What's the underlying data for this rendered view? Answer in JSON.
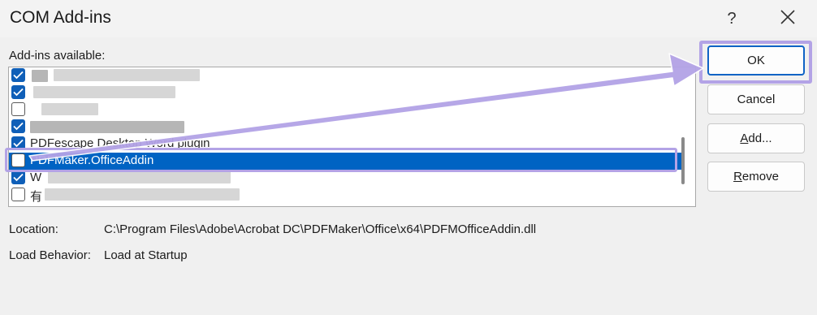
{
  "window": {
    "title": "COM Add-ins",
    "help_label": "?"
  },
  "addins": {
    "label": "Add-ins available:",
    "label_mnemonic": "d",
    "items": [
      {
        "checked": true,
        "text": ""
      },
      {
        "checked": true,
        "text": ""
      },
      {
        "checked": false,
        "text": ""
      },
      {
        "checked": true,
        "text": ""
      },
      {
        "checked": true,
        "text": "PDFescape Desktop Word plugin"
      },
      {
        "checked": false,
        "text": "PDFMaker.OfficeAddin",
        "selected": true
      },
      {
        "checked": true,
        "text": "W"
      },
      {
        "checked": false,
        "text": "有"
      }
    ]
  },
  "buttons": {
    "ok": "OK",
    "cancel": "Cancel",
    "add_mnemonic": "A",
    "add_rest": "dd...",
    "remove_mnemonic": "R",
    "remove_rest": "emove"
  },
  "details": {
    "location_label": "Location:",
    "location_value": "C:\\Program Files\\Adobe\\Acrobat DC\\PDFMaker\\Office\\x64\\PDFMOfficeAddin.dll",
    "load_behavior_label": "Load Behavior:",
    "load_behavior_value": "Load at Startup"
  },
  "colors": {
    "accent": "#0063c3",
    "highlight_annotation": "#b3a3e6",
    "checkbox_checked": "#0f5fb8"
  },
  "icons": {
    "close": "close-icon",
    "check": "checkmark-icon"
  }
}
